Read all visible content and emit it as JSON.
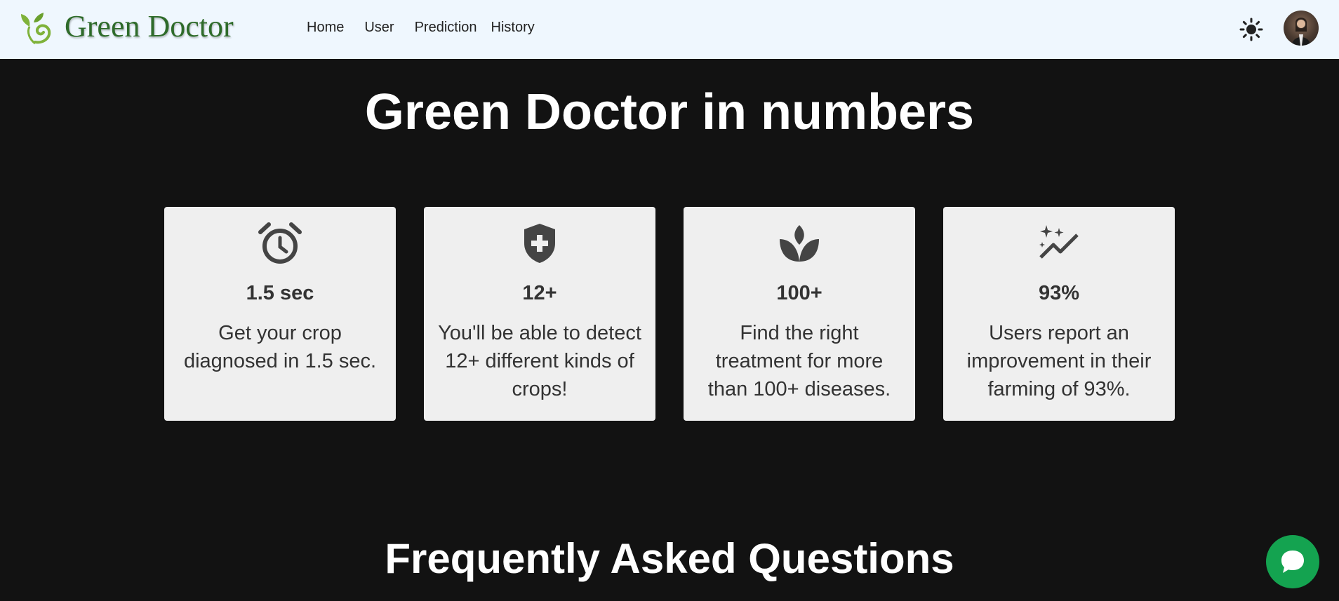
{
  "brand": {
    "name": "Green Doctor",
    "logo_icon": "sprout-icon"
  },
  "nav": {
    "items": [
      {
        "label": "Home"
      },
      {
        "label": "User"
      },
      {
        "label": "Prediction"
      },
      {
        "label": "History"
      }
    ],
    "theme_icon": "sun-icon",
    "avatar_icon": "user-avatar"
  },
  "numbers_section": {
    "title": "Green Doctor in numbers",
    "cards": [
      {
        "icon": "alarm-clock-icon",
        "stat": "1.5 sec",
        "description": "Get your crop diagnosed in 1.5 sec."
      },
      {
        "icon": "shield-plus-icon",
        "stat": "12+",
        "description": "You'll be able to detect 12+ different kinds of crops!"
      },
      {
        "icon": "spa-leaf-icon",
        "stat": "100+",
        "description": "Find the right treatment for more than 100+ diseases."
      },
      {
        "icon": "auto-graph-icon",
        "stat": "93%",
        "description": "Users report an improvement in their farming of 93%."
      }
    ]
  },
  "faq_section": {
    "title": "Frequently Asked Questions"
  },
  "chat": {
    "icon": "chat-bubble-icon"
  },
  "colors": {
    "navbar_bg": "#eff7fe",
    "page_bg": "#121212",
    "card_bg": "#efefef",
    "brand_text": "#2e6b2a",
    "chat_accent": "#14a350"
  }
}
